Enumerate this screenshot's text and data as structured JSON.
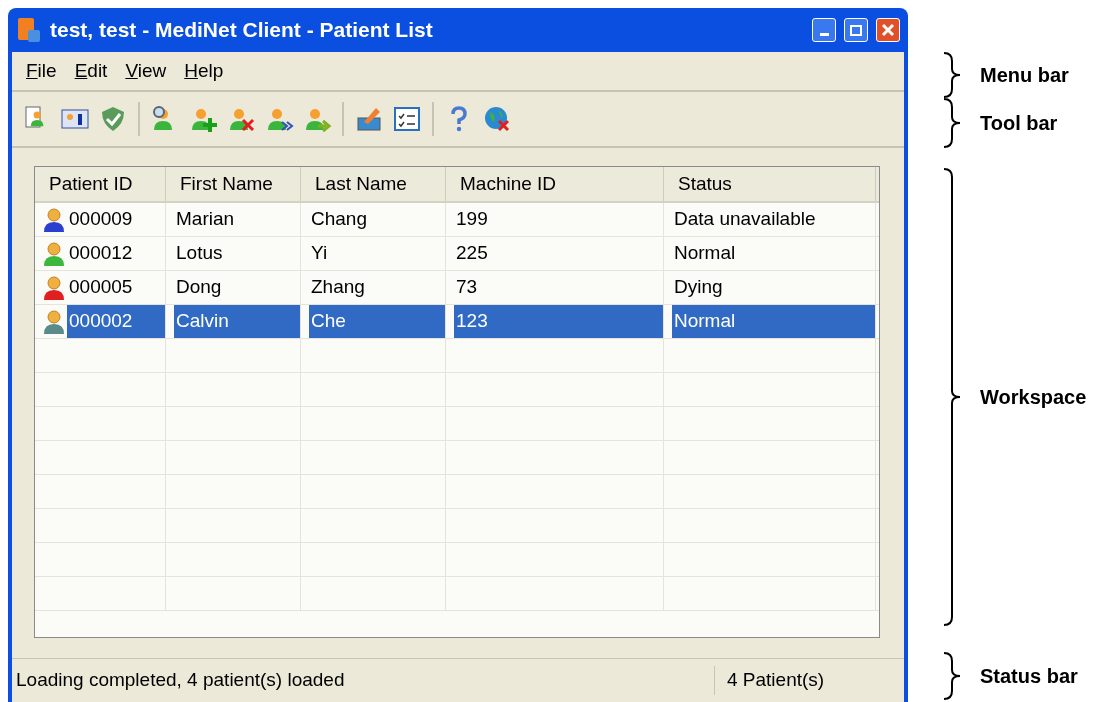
{
  "window": {
    "title": "test, test - MediNet Client - Patient List"
  },
  "menu": [
    {
      "label": "File"
    },
    {
      "label": "Edit"
    },
    {
      "label": "View"
    },
    {
      "label": "Help"
    }
  ],
  "table": {
    "columns": [
      "Patient ID",
      "First Name",
      "Last Name",
      "Machine ID",
      "Status"
    ],
    "rows": [
      {
        "color": "#2a3fd0",
        "selected": false,
        "cells": [
          "000009",
          "Marian",
          "Chang",
          "199",
          "Data unavailable"
        ]
      },
      {
        "color": "#3cb83c",
        "selected": false,
        "cells": [
          "000012",
          "Lotus",
          "Yi",
          "225",
          "Normal"
        ]
      },
      {
        "color": "#e02020",
        "selected": false,
        "cells": [
          "000005",
          "Dong",
          "Zhang",
          "73",
          "Dying"
        ]
      },
      {
        "color": "#5a8a8a",
        "selected": true,
        "cells": [
          "000002",
          "Calvin",
          "Che",
          "123",
          "Normal"
        ]
      }
    ]
  },
  "status_bar": {
    "message": "Loading completed, 4 patient(s) loaded",
    "count": "4 Patient(s)"
  },
  "annotations": [
    {
      "label": "Menu bar"
    },
    {
      "label": "Tool bar"
    },
    {
      "label": "Workspace"
    },
    {
      "label": "Status bar"
    }
  ]
}
